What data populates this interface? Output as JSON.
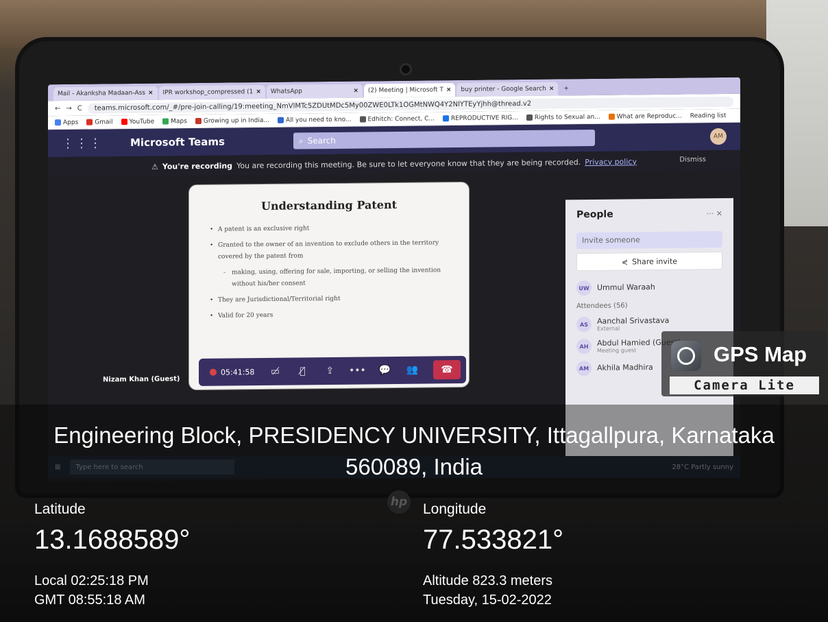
{
  "browser": {
    "tabs": [
      {
        "label": "Mail - Akanksha Madaan-Ass",
        "icon": "outlook-icon"
      },
      {
        "label": "IPR workshop_compressed (1",
        "icon": "drive-icon"
      },
      {
        "label": "WhatsApp",
        "icon": "whatsapp-icon"
      },
      {
        "label": "(2) Meeting | Microsoft T",
        "icon": "teams-icon",
        "active": true
      },
      {
        "label": "buy printer - Google Search",
        "icon": "google-icon"
      }
    ],
    "url": "teams.microsoft.com/_#/pre-join-calling/19:meeting_NmVlMTc5ZDUtMDc5My00ZWE0LTk1OGMtNWQ4Y2NlYTEyYjhh@thread.v2",
    "bookmarks": [
      "Apps",
      "Gmail",
      "YouTube",
      "Maps",
      "Growing up in India...",
      "All you need to kno...",
      "Edhitch: Connect, C...",
      "REPRODUCTIVE RIG...",
      "Rights to Sexual an...",
      "What are Reproduc...",
      "Reading list"
    ]
  },
  "teams": {
    "title": "Microsoft Teams",
    "search_placeholder": "Search",
    "recording_bold": "You're recording",
    "recording_text": "You are recording this meeting. Be sure to let everyone know that they are being recorded.",
    "privacy_link": "Privacy policy",
    "dismiss": "Dismiss",
    "timer": "05:41:58",
    "guest_name": "Nizam Khan (Guest)"
  },
  "slide": {
    "title": "Understanding Patent",
    "bullets": [
      "A patent is an exclusive right",
      "Granted to the owner of an invention to exclude others in the territory covered by the patent from",
      "making, using, offering for sale, importing, or selling the invention without his/her consent",
      "They are Jurisdictional/Territorial right",
      "Valid for 20 years"
    ]
  },
  "people": {
    "title": "People",
    "invite_placeholder": "Invite someone",
    "share_invite": "Share invite",
    "organizer": {
      "initials": "UW",
      "name": "Ummul Waraah"
    },
    "attendees_header": "Attendees (56)",
    "attendees": [
      {
        "initials": "AS",
        "name": "Aanchal Srivastava",
        "sub": "External"
      },
      {
        "initials": "AH",
        "name": "Abdul Hamied (Guest)",
        "sub": "Meeting guest"
      },
      {
        "initials": "AM",
        "name": "Akhila Madhira",
        "sub": ""
      }
    ]
  },
  "taskbar": {
    "search": "Type here to search",
    "weather": "28°C Partly sunny"
  },
  "gps": {
    "brand": "GPS Map",
    "brand_sub": "Camera Lite",
    "address_line1": "Engineering Block, PRESIDENCY UNIVERSITY, Ittagallpura, Karnataka",
    "address_line2": "560089, India",
    "latitude_label": "Latitude",
    "latitude": "13.1688589°",
    "longitude_label": "Longitude",
    "longitude": "77.533821°",
    "local_time": "Local 02:25:18 PM",
    "gmt_time": "GMT 08:55:18 AM",
    "altitude": "Altitude 823.3 meters",
    "date": "Tuesday, 15-02-2022"
  }
}
